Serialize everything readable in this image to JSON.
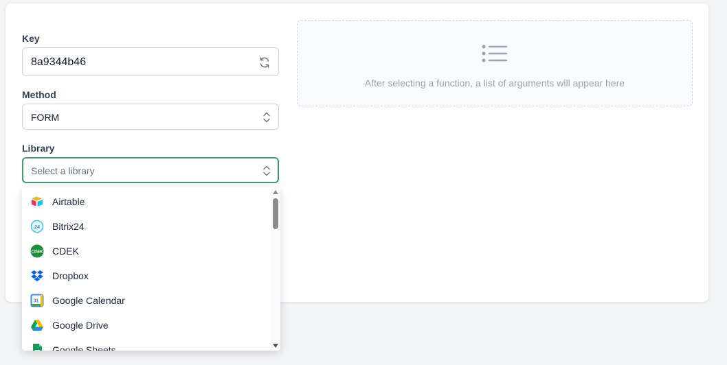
{
  "form": {
    "key": {
      "label": "Key",
      "value": "8a9344b46",
      "icon": "refresh-icon"
    },
    "method": {
      "label": "Method",
      "value": "FORM",
      "icon": "chevron-up-down-icon"
    },
    "library": {
      "label": "Library",
      "placeholder": "Select a library",
      "icon": "chevron-up-down-icon"
    }
  },
  "arguments_panel": {
    "icon": "list-icon",
    "message": "After selecting a function, a list of arguments will appear here"
  },
  "library_options": [
    {
      "name": "Airtable",
      "icon": "airtable-logo"
    },
    {
      "name": "Bitrix24",
      "icon": "bitrix24-logo"
    },
    {
      "name": "CDEK",
      "icon": "cdek-logo"
    },
    {
      "name": "Dropbox",
      "icon": "dropbox-logo"
    },
    {
      "name": "Google Calendar",
      "icon": "google-calendar-logo"
    },
    {
      "name": "Google Drive",
      "icon": "google-drive-logo"
    },
    {
      "name": "Google Sheets",
      "icon": "google-sheets-logo"
    }
  ],
  "colors": {
    "focus_border": "#3f9e6b",
    "page_bg": "#f3f4f6"
  }
}
